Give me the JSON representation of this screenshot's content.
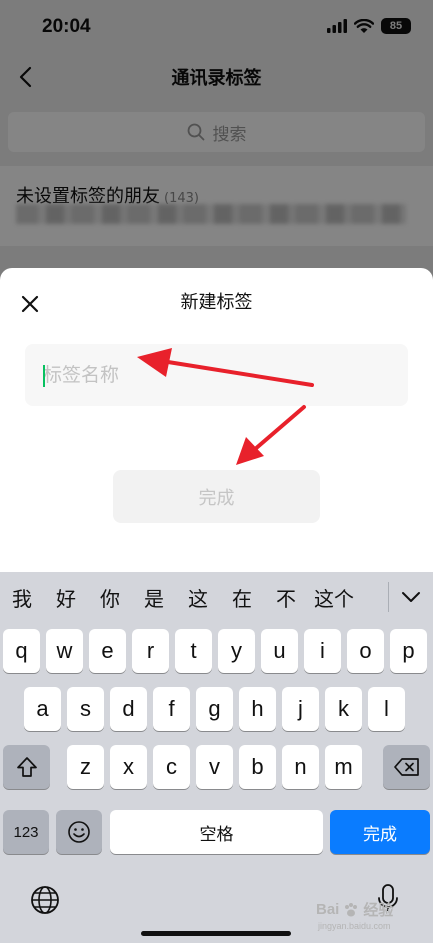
{
  "status": {
    "time": "20:04",
    "battery": "85"
  },
  "nav": {
    "title": "通讯录标签"
  },
  "search": {
    "label": "搜索"
  },
  "tag_row": {
    "title": "未设置标签的朋友",
    "count": "(143)"
  },
  "sheet": {
    "title": "新建标签",
    "input_placeholder": "标签名称",
    "input_value": "",
    "done_label": "完成"
  },
  "candidates": [
    "我",
    "好",
    "你",
    "是",
    "这",
    "在",
    "不",
    "这个"
  ],
  "keyboard": {
    "row1": [
      "q",
      "w",
      "e",
      "r",
      "t",
      "y",
      "u",
      "i",
      "o",
      "p"
    ],
    "row2": [
      "a",
      "s",
      "d",
      "f",
      "g",
      "h",
      "j",
      "k",
      "l"
    ],
    "row3": [
      "z",
      "x",
      "c",
      "v",
      "b",
      "n",
      "m"
    ],
    "num_label": "123",
    "space_label": "空格",
    "return_label": "完成"
  },
  "watermark": {
    "brand": "Bai",
    "brand2": "经验",
    "sub": "jingyan.baidu.com"
  },
  "colors": {
    "accent_blue": "#0a7cff",
    "caret_green": "#07c160",
    "arrow_red": "#e8212b"
  },
  "icons": {
    "back": "chevron-left-icon",
    "close": "close-icon",
    "search": "search-icon",
    "shift": "shift-icon",
    "backspace": "backspace-icon",
    "emoji": "emoji-icon",
    "globe": "globe-icon",
    "mic": "microphone-icon",
    "expand": "chevron-down-icon"
  }
}
